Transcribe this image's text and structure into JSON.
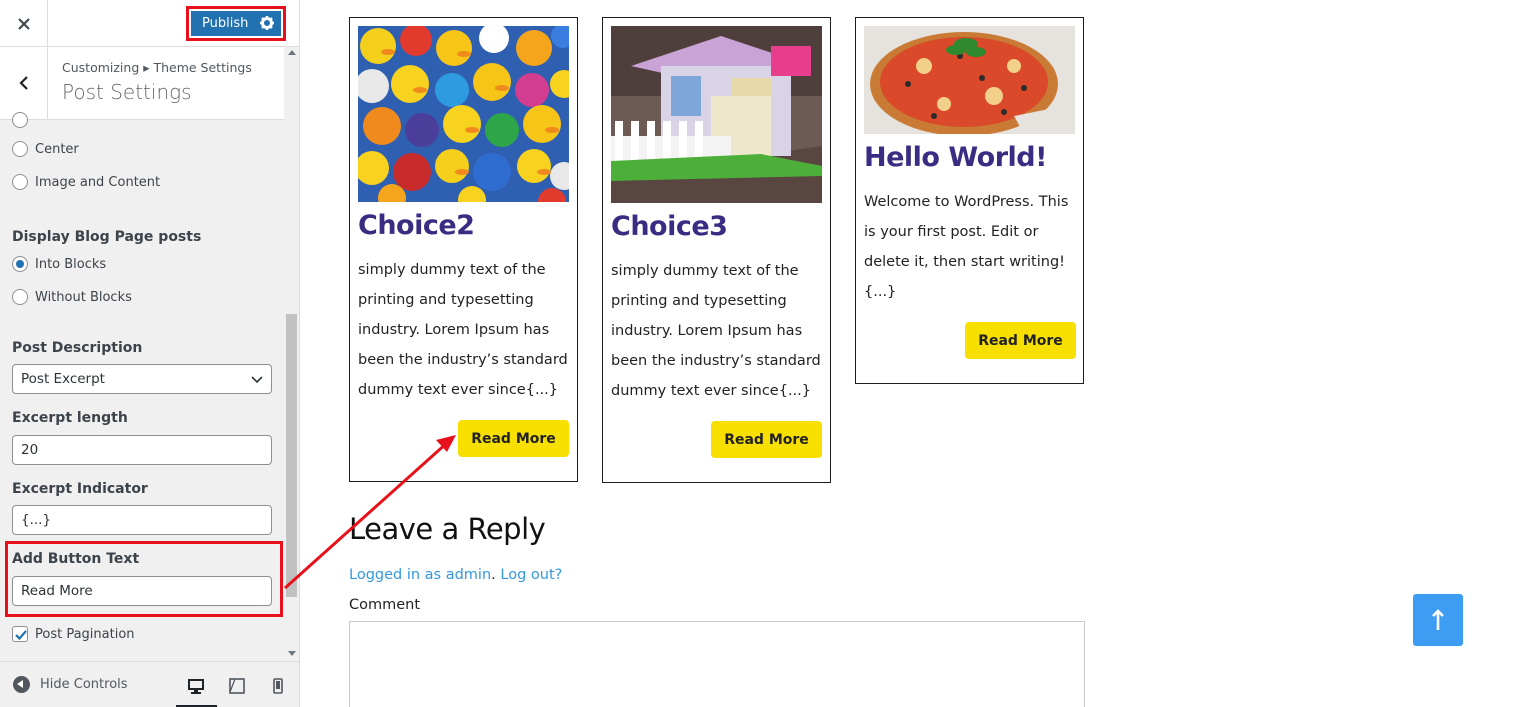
{
  "customizer": {
    "publish_label": "Publish",
    "breadcrumb": "Customizing ▸ Theme Settings",
    "section_title": "Post Settings",
    "layout_options": [
      {
        "label": "Center"
      },
      {
        "label": "Image and Content"
      }
    ],
    "display_posts": {
      "title": "Display Blog Page posts",
      "options": [
        {
          "label": "Into Blocks",
          "checked": true
        },
        {
          "label": "Without Blocks",
          "checked": false
        }
      ]
    },
    "post_description": {
      "title": "Post Description",
      "selected": "Post Excerpt"
    },
    "excerpt_length": {
      "title": "Excerpt length",
      "value": "20"
    },
    "excerpt_indicator": {
      "title": "Excerpt Indicator",
      "value": "{...}"
    },
    "button_text": {
      "title": "Add Button Text",
      "value": "Read More"
    },
    "pagination": {
      "label": "Post Pagination",
      "checked": true
    },
    "hide_controls": "Hide Controls"
  },
  "posts": [
    {
      "title": "Choice2",
      "excerpt_lines": [
        "simply dummy text of the",
        "printing and typesetting",
        "industry. Lorem Ipsum has",
        "been the industry’s standard",
        "dummy text ever since{...}"
      ],
      "button": "Read More",
      "image": "rubber-ducks"
    },
    {
      "title": "Choice3",
      "excerpt_lines": [
        "simply dummy text of the",
        "printing and typesetting",
        "industry. Lorem Ipsum has",
        "been the industry’s standard",
        "dummy text ever since{...}"
      ],
      "button": "Read More",
      "image": "toy-house"
    },
    {
      "title": "Hello World!",
      "excerpt_lines": [
        "Welcome to WordPress. This",
        "is your first post. Edit or",
        "delete it, then start writing!",
        "{...}"
      ],
      "button": "Read More",
      "image": "pizza"
    }
  ],
  "reply": {
    "title": "Leave a Reply",
    "logged_in_link": "Logged in as admin",
    "separator": ".",
    "logout_link": "Log out?",
    "comment_label": "Comment"
  },
  "colors": {
    "accent": "#2271b1",
    "highlight": "#e8111b",
    "button": "#f7e000",
    "title": "#3b2c83",
    "link": "#3498db",
    "to_top": "#3d9df3"
  }
}
